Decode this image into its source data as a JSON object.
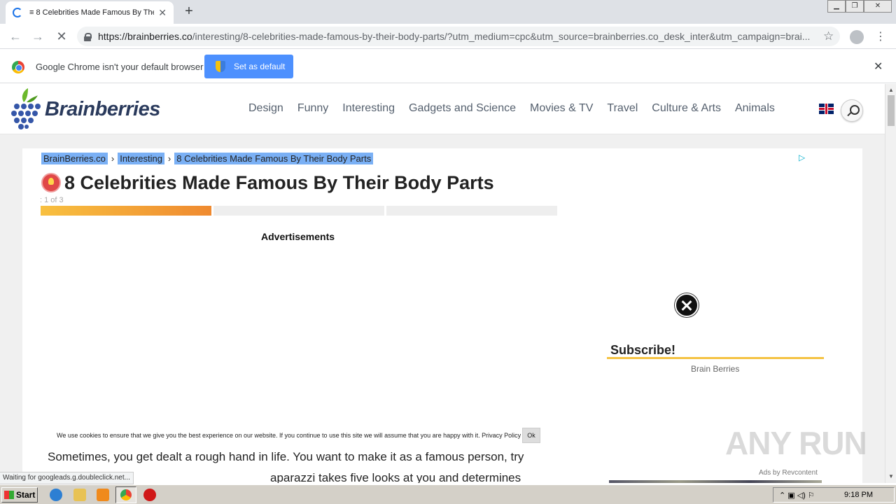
{
  "browser": {
    "tab_title": "≡ 8 Celebrities Made Famous By The",
    "url_host": "https://brainberries.co",
    "url_path": "/interesting/8-celebrities-made-famous-by-their-body-parts/?utm_medium=cpc&utm_source=brainberries.co_desk_inter&utm_campaign=brai...",
    "infobar_text": "Google Chrome isn't your default browser",
    "set_default_label": "Set as default",
    "status_text": "Waiting for googleads.g.doubleclick.net..."
  },
  "site": {
    "logo_text": "Brainberries",
    "nav": [
      "Design",
      "Funny",
      "Interesting",
      "Gadgets and Science",
      "Movies & TV",
      "Travel",
      "Culture & Arts",
      "Animals"
    ]
  },
  "article": {
    "breadcrumb": [
      "BrainBerries.co",
      "Interesting",
      "8 Celebrities Made Famous By Their Body Parts"
    ],
    "title": "8 Celebrities Made Famous By Their Body Parts",
    "page_count": ": 1 of 3",
    "progress": {
      "current": 1,
      "total": 3
    },
    "ads_label": "Advertisements",
    "cookie_text": "We use cookies to ensure that we give you the best experience on our website. If you continue to use this site we will assume that you are happy with it. Privacy Policy",
    "cookie_ok": "Ok",
    "body_line1": "Sometimes, you get dealt a rough hand in life. You want to make it as a famous person, try",
    "body_line2": "aparazzi takes five looks at you and determines"
  },
  "sidebar": {
    "subscribe_title": "Subscribe!",
    "subscribe_name": "Brain Berries",
    "ads_by": "Ads by Revcontent"
  },
  "watermark": "ANY RUN",
  "taskbar": {
    "start_label": "Start",
    "clock": "9:18 PM"
  },
  "colors": {
    "accent_blue": "#4d90fe",
    "progress_orange": "#ef8a30",
    "subscribe_yellow": "#f5c342",
    "logo_navy": "#2a3a5c"
  }
}
